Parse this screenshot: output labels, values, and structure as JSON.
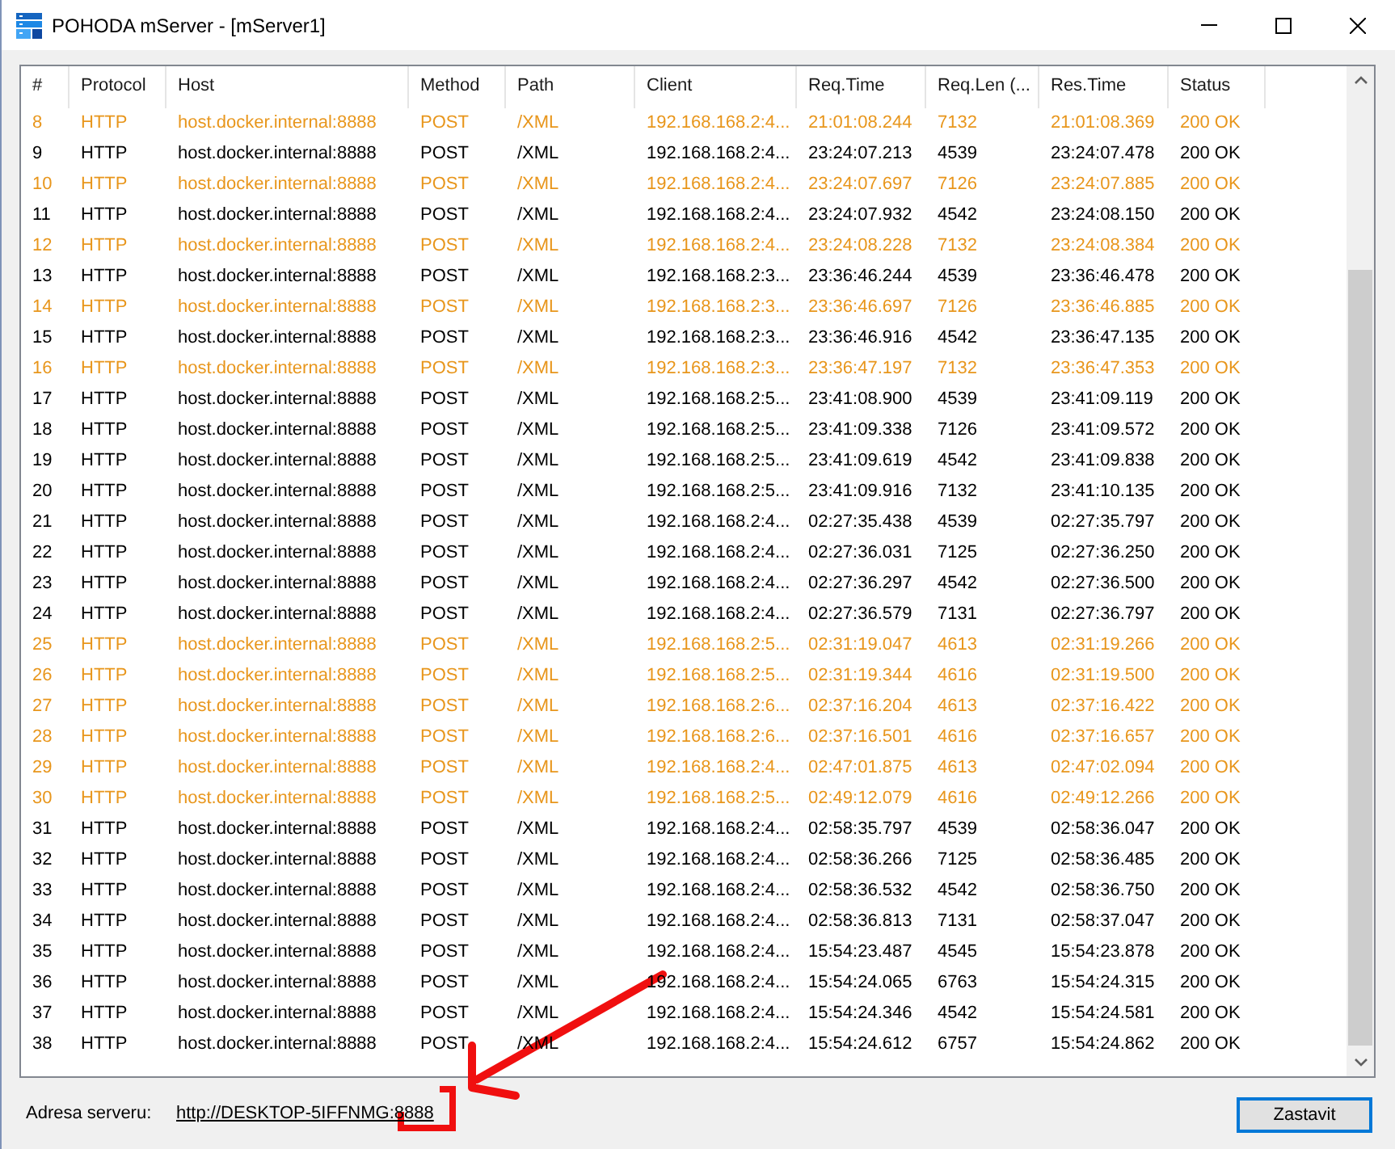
{
  "window": {
    "title": "POHODA mServer - [mServer1]"
  },
  "table": {
    "columns": [
      "#",
      "Protocol",
      "Host",
      "Method",
      "Path",
      "Client",
      "Req.Time",
      "Req.Len (...",
      "Res.Time",
      "Status"
    ],
    "rows": [
      {
        "cells": [
          "8",
          "HTTP",
          "host.docker.internal:8888",
          "POST",
          "/XML",
          "192.168.168.2:4...",
          "21:01:08.244",
          "7132",
          "21:01:08.369",
          "200 OK"
        ],
        "highlighted": true
      },
      {
        "cells": [
          "9",
          "HTTP",
          "host.docker.internal:8888",
          "POST",
          "/XML",
          "192.168.168.2:4...",
          "23:24:07.213",
          "4539",
          "23:24:07.478",
          "200 OK"
        ],
        "highlighted": false
      },
      {
        "cells": [
          "10",
          "HTTP",
          "host.docker.internal:8888",
          "POST",
          "/XML",
          "192.168.168.2:4...",
          "23:24:07.697",
          "7126",
          "23:24:07.885",
          "200 OK"
        ],
        "highlighted": true
      },
      {
        "cells": [
          "11",
          "HTTP",
          "host.docker.internal:8888",
          "POST",
          "/XML",
          "192.168.168.2:4...",
          "23:24:07.932",
          "4542",
          "23:24:08.150",
          "200 OK"
        ],
        "highlighted": false
      },
      {
        "cells": [
          "12",
          "HTTP",
          "host.docker.internal:8888",
          "POST",
          "/XML",
          "192.168.168.2:4...",
          "23:24:08.228",
          "7132",
          "23:24:08.384",
          "200 OK"
        ],
        "highlighted": true
      },
      {
        "cells": [
          "13",
          "HTTP",
          "host.docker.internal:8888",
          "POST",
          "/XML",
          "192.168.168.2:3...",
          "23:36:46.244",
          "4539",
          "23:36:46.478",
          "200 OK"
        ],
        "highlighted": false
      },
      {
        "cells": [
          "14",
          "HTTP",
          "host.docker.internal:8888",
          "POST",
          "/XML",
          "192.168.168.2:3...",
          "23:36:46.697",
          "7126",
          "23:36:46.885",
          "200 OK"
        ],
        "highlighted": true
      },
      {
        "cells": [
          "15",
          "HTTP",
          "host.docker.internal:8888",
          "POST",
          "/XML",
          "192.168.168.2:3...",
          "23:36:46.916",
          "4542",
          "23:36:47.135",
          "200 OK"
        ],
        "highlighted": false
      },
      {
        "cells": [
          "16",
          "HTTP",
          "host.docker.internal:8888",
          "POST",
          "/XML",
          "192.168.168.2:3...",
          "23:36:47.197",
          "7132",
          "23:36:47.353",
          "200 OK"
        ],
        "highlighted": true
      },
      {
        "cells": [
          "17",
          "HTTP",
          "host.docker.internal:8888",
          "POST",
          "/XML",
          "192.168.168.2:5...",
          "23:41:08.900",
          "4539",
          "23:41:09.119",
          "200 OK"
        ],
        "highlighted": false
      },
      {
        "cells": [
          "18",
          "HTTP",
          "host.docker.internal:8888",
          "POST",
          "/XML",
          "192.168.168.2:5...",
          "23:41:09.338",
          "7126",
          "23:41:09.572",
          "200 OK"
        ],
        "highlighted": false
      },
      {
        "cells": [
          "19",
          "HTTP",
          "host.docker.internal:8888",
          "POST",
          "/XML",
          "192.168.168.2:5...",
          "23:41:09.619",
          "4542",
          "23:41:09.838",
          "200 OK"
        ],
        "highlighted": false
      },
      {
        "cells": [
          "20",
          "HTTP",
          "host.docker.internal:8888",
          "POST",
          "/XML",
          "192.168.168.2:5...",
          "23:41:09.916",
          "7132",
          "23:41:10.135",
          "200 OK"
        ],
        "highlighted": false
      },
      {
        "cells": [
          "21",
          "HTTP",
          "host.docker.internal:8888",
          "POST",
          "/XML",
          "192.168.168.2:4...",
          "02:27:35.438",
          "4539",
          "02:27:35.797",
          "200 OK"
        ],
        "highlighted": false
      },
      {
        "cells": [
          "22",
          "HTTP",
          "host.docker.internal:8888",
          "POST",
          "/XML",
          "192.168.168.2:4...",
          "02:27:36.031",
          "7125",
          "02:27:36.250",
          "200 OK"
        ],
        "highlighted": false
      },
      {
        "cells": [
          "23",
          "HTTP",
          "host.docker.internal:8888",
          "POST",
          "/XML",
          "192.168.168.2:4...",
          "02:27:36.297",
          "4542",
          "02:27:36.500",
          "200 OK"
        ],
        "highlighted": false
      },
      {
        "cells": [
          "24",
          "HTTP",
          "host.docker.internal:8888",
          "POST",
          "/XML",
          "192.168.168.2:4...",
          "02:27:36.579",
          "7131",
          "02:27:36.797",
          "200 OK"
        ],
        "highlighted": false
      },
      {
        "cells": [
          "25",
          "HTTP",
          "host.docker.internal:8888",
          "POST",
          "/XML",
          "192.168.168.2:5...",
          "02:31:19.047",
          "4613",
          "02:31:19.266",
          "200 OK"
        ],
        "highlighted": true
      },
      {
        "cells": [
          "26",
          "HTTP",
          "host.docker.internal:8888",
          "POST",
          "/XML",
          "192.168.168.2:5...",
          "02:31:19.344",
          "4616",
          "02:31:19.500",
          "200 OK"
        ],
        "highlighted": true
      },
      {
        "cells": [
          "27",
          "HTTP",
          "host.docker.internal:8888",
          "POST",
          "/XML",
          "192.168.168.2:6...",
          "02:37:16.204",
          "4613",
          "02:37:16.422",
          "200 OK"
        ],
        "highlighted": true
      },
      {
        "cells": [
          "28",
          "HTTP",
          "host.docker.internal:8888",
          "POST",
          "/XML",
          "192.168.168.2:6...",
          "02:37:16.501",
          "4616",
          "02:37:16.657",
          "200 OK"
        ],
        "highlighted": true
      },
      {
        "cells": [
          "29",
          "HTTP",
          "host.docker.internal:8888",
          "POST",
          "/XML",
          "192.168.168.2:4...",
          "02:47:01.875",
          "4613",
          "02:47:02.094",
          "200 OK"
        ],
        "highlighted": true
      },
      {
        "cells": [
          "30",
          "HTTP",
          "host.docker.internal:8888",
          "POST",
          "/XML",
          "192.168.168.2:5...",
          "02:49:12.079",
          "4616",
          "02:49:12.266",
          "200 OK"
        ],
        "highlighted": true
      },
      {
        "cells": [
          "31",
          "HTTP",
          "host.docker.internal:8888",
          "POST",
          "/XML",
          "192.168.168.2:4...",
          "02:58:35.797",
          "4539",
          "02:58:36.047",
          "200 OK"
        ],
        "highlighted": false
      },
      {
        "cells": [
          "32",
          "HTTP",
          "host.docker.internal:8888",
          "POST",
          "/XML",
          "192.168.168.2:4...",
          "02:58:36.266",
          "7125",
          "02:58:36.485",
          "200 OK"
        ],
        "highlighted": false
      },
      {
        "cells": [
          "33",
          "HTTP",
          "host.docker.internal:8888",
          "POST",
          "/XML",
          "192.168.168.2:4...",
          "02:58:36.532",
          "4542",
          "02:58:36.750",
          "200 OK"
        ],
        "highlighted": false
      },
      {
        "cells": [
          "34",
          "HTTP",
          "host.docker.internal:8888",
          "POST",
          "/XML",
          "192.168.168.2:4...",
          "02:58:36.813",
          "7131",
          "02:58:37.047",
          "200 OK"
        ],
        "highlighted": false
      },
      {
        "cells": [
          "35",
          "HTTP",
          "host.docker.internal:8888",
          "POST",
          "/XML",
          "192.168.168.2:4...",
          "15:54:23.487",
          "4545",
          "15:54:23.878",
          "200 OK"
        ],
        "highlighted": false
      },
      {
        "cells": [
          "36",
          "HTTP",
          "host.docker.internal:8888",
          "POST",
          "/XML",
          "192.168.168.2:4...",
          "15:54:24.065",
          "6763",
          "15:54:24.315",
          "200 OK"
        ],
        "highlighted": false
      },
      {
        "cells": [
          "37",
          "HTTP",
          "host.docker.internal:8888",
          "POST",
          "/XML",
          "192.168.168.2:4...",
          "15:54:24.346",
          "4542",
          "15:54:24.581",
          "200 OK"
        ],
        "highlighted": false
      },
      {
        "cells": [
          "38",
          "HTTP",
          "host.docker.internal:8888",
          "POST",
          "/XML",
          "192.168.168.2:4...",
          "15:54:24.612",
          "6757",
          "15:54:24.862",
          "200 OK"
        ],
        "highlighted": false
      }
    ]
  },
  "footer": {
    "address_label": "Adresa serveru:",
    "address_link": "http://DESKTOP-5IFFNMG:8888",
    "stop_button": "Zastavit"
  }
}
